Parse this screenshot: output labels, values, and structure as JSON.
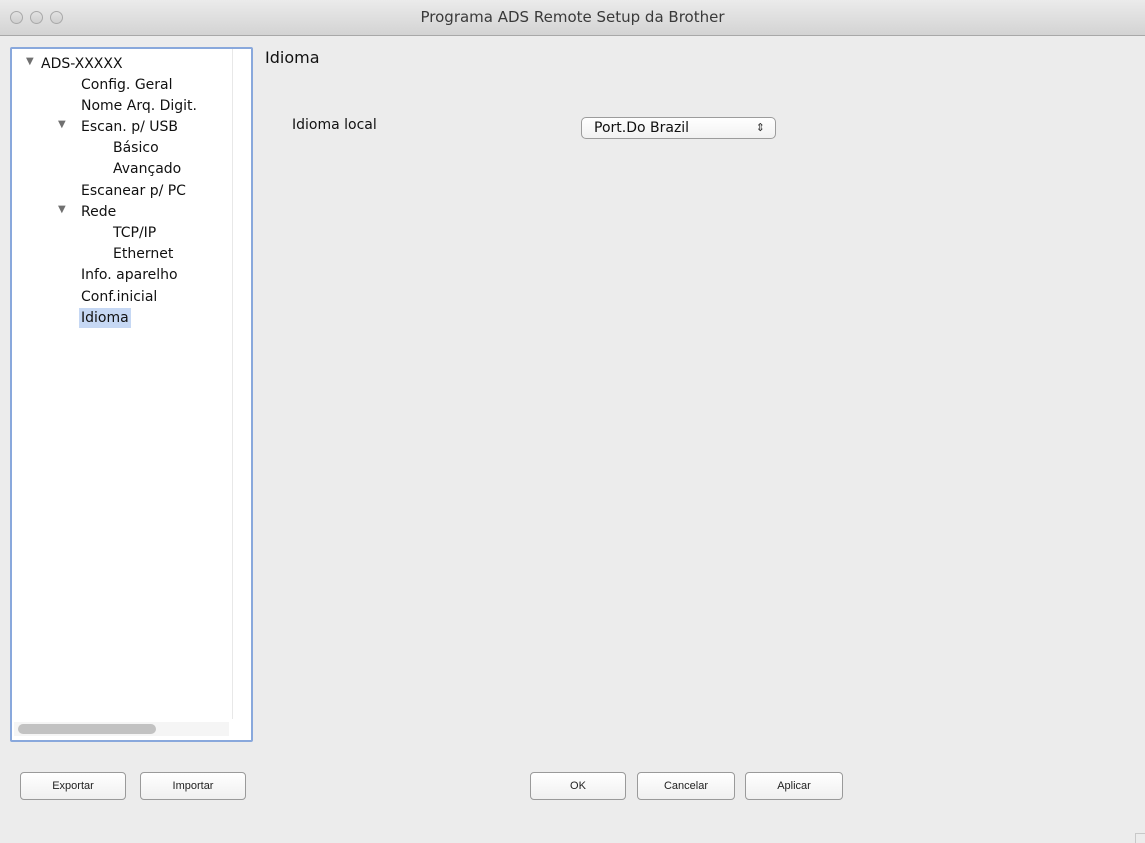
{
  "window": {
    "title": "Programa ADS Remote Setup da Brother"
  },
  "sidebar": {
    "items": [
      {
        "label": "ADS-XXXXX",
        "expanded": true
      },
      {
        "label": "Config. Geral"
      },
      {
        "label": "Nome Arq. Digit."
      },
      {
        "label": "Escan. p/ USB",
        "expanded": true
      },
      {
        "label": "Básico"
      },
      {
        "label": "Avançado"
      },
      {
        "label": "Escanear p/ PC"
      },
      {
        "label": "Rede",
        "expanded": true
      },
      {
        "label": "TCP/IP"
      },
      {
        "label": "Ethernet"
      },
      {
        "label": "Info. aparelho"
      },
      {
        "label": "Conf.inicial"
      },
      {
        "label": "Idioma",
        "selected": true
      }
    ],
    "disclosure_icon": "triangle-down-icon"
  },
  "main": {
    "section_title": "Idioma",
    "fields": [
      {
        "label": "Idioma local",
        "value": "Port.Do Brazil"
      }
    ]
  },
  "footer": {
    "export_label": "Exportar",
    "import_label": "Importar",
    "ok_label": "OK",
    "cancel_label": "Cancelar",
    "apply_label": "Aplicar"
  },
  "colors": {
    "selection": "#c6d8f4",
    "focus_border": "#89a8dc"
  }
}
